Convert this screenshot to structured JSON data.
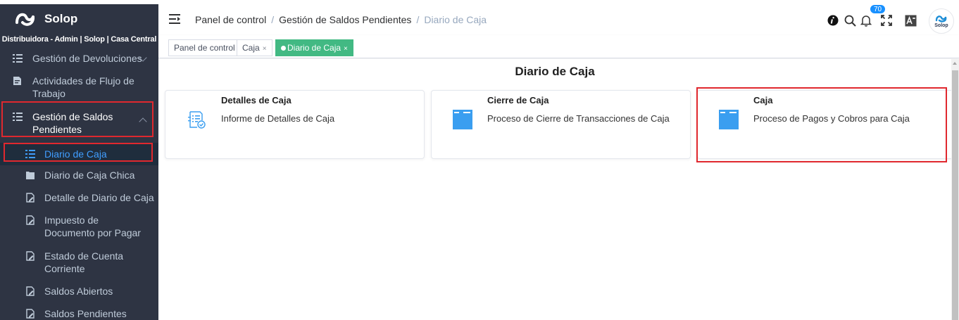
{
  "app": {
    "name": "Solop",
    "org_line": "Distribuidora - Admin | Solop | Casa Central"
  },
  "sidebar": {
    "items": [
      {
        "label": "Gestión de Devoluciones",
        "icon": "list-icon"
      },
      {
        "label": "Actividades de Flujo de Trabajo",
        "icon": "document-icon"
      },
      {
        "label": "Gestión de Saldos Pendientes",
        "icon": "list-icon"
      },
      {
        "label": "Diario de Caja",
        "icon": "list-icon",
        "active": true
      },
      {
        "label": "Diario de Caja Chica",
        "icon": "folder-icon"
      },
      {
        "label": "Detalle de Diario de Caja",
        "icon": "edit-doc-icon"
      },
      {
        "label": "Impuesto de Documento por Pagar",
        "icon": "edit-doc-icon"
      },
      {
        "label": "Estado de Cuenta Corriente",
        "icon": "edit-doc-icon"
      },
      {
        "label": "Saldos Abiertos",
        "icon": "edit-doc-icon"
      },
      {
        "label": "Saldos Pendientes",
        "icon": "edit-doc-icon"
      }
    ]
  },
  "header": {
    "breadcrumb": [
      "Panel de control",
      "Gestión de Saldos Pendientes",
      "Diario de Caja"
    ],
    "notification_count": "70",
    "avatar_text": "Solop"
  },
  "tags": [
    {
      "label": "Panel de control",
      "closable": false
    },
    {
      "label": "Caja",
      "closable": true
    },
    {
      "label": "Diario de Caja",
      "closable": true,
      "active": true
    }
  ],
  "close_glyph": "×",
  "main": {
    "title": "Diario de Caja",
    "cards": [
      {
        "title": "Detalles de Caja",
        "description": "Informe de Detalles de Caja",
        "icon": "report-check-icon"
      },
      {
        "title": "Cierre de Caja",
        "description": "Proceso de Cierre de Transacciones de Caja",
        "icon": "process-folder-icon"
      },
      {
        "title": "Caja",
        "description": "Proceso de Pagos y Cobros para Caja",
        "icon": "process-folder-icon",
        "highlighted": true
      }
    ]
  },
  "colors": {
    "sidebar_bg": "#2e3443",
    "sidebar_text": "#bfcbd9",
    "active_text": "#409eff",
    "tag_active": "#42b983",
    "highlight_border": "#e0282e",
    "card_icon": "#3a9ef0",
    "badge": "#1890ff"
  }
}
